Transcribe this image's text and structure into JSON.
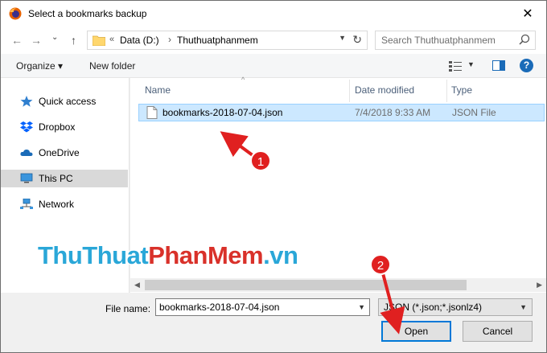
{
  "window": {
    "title": "Select a bookmarks backup",
    "close_glyph": "✕"
  },
  "nav": {
    "back": "←",
    "forward": "→",
    "recent": "⌄",
    "up": "↑"
  },
  "address": {
    "overflow": "«",
    "crumbs": [
      "Data (D:)",
      "Thuthuatphanmem"
    ],
    "separator": "›"
  },
  "search": {
    "placeholder": "Search Thuthuatphanmem"
  },
  "toolbar": {
    "organize": "Organize ▾",
    "new_folder": "New folder",
    "help": "?"
  },
  "sidebar": {
    "items": [
      {
        "label": "Quick access",
        "icon": "star-icon",
        "selected": false
      },
      {
        "label": "Dropbox",
        "icon": "dropbox-icon",
        "selected": false
      },
      {
        "label": "OneDrive",
        "icon": "cloud-icon",
        "selected": false
      },
      {
        "label": "This PC",
        "icon": "computer-icon",
        "selected": true
      },
      {
        "label": "Network",
        "icon": "network-icon",
        "selected": false
      }
    ]
  },
  "columns": {
    "name": "Name",
    "date": "Date modified",
    "type": "Type"
  },
  "files": [
    {
      "name": "bookmarks-2018-07-04.json",
      "date": "7/4/2018 9:33 AM",
      "type": "JSON File"
    }
  ],
  "bottom": {
    "file_name_label": "File name:",
    "file_name_value": "bookmarks-2018-07-04.json",
    "filter_value": "JSON (*.json;*.jsonlz4)",
    "open_label": "Open",
    "cancel_label": "Cancel"
  },
  "watermark": {
    "part1": "ThuThuat",
    "part2": "PhanMem",
    "part3": ".vn"
  },
  "annotations": {
    "badge1": "1",
    "badge2": "2",
    "color": "#e02020"
  },
  "colors": {
    "selection": "#cce8ff",
    "accent": "#0078d7"
  }
}
